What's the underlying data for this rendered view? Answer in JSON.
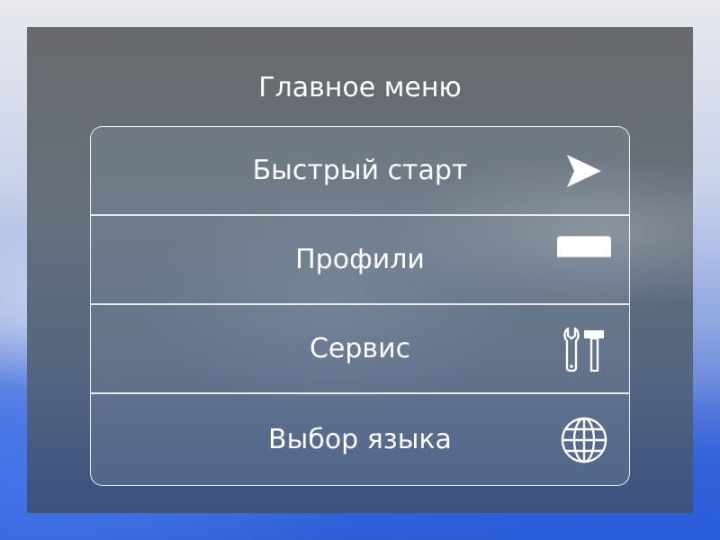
{
  "menu": {
    "title": "Главное меню",
    "items": [
      {
        "label": "Быстрый старт",
        "icon": "arrow-right-icon"
      },
      {
        "label": "Профили",
        "icon": "profile-card-icon"
      },
      {
        "label": "Сервис",
        "icon": "tools-icon"
      },
      {
        "label": "Выбор языка",
        "icon": "globe-icon"
      }
    ]
  },
  "colors": {
    "text": "#ffffff",
    "panel": "#65707d",
    "background_accent": "#2f5fd6"
  }
}
